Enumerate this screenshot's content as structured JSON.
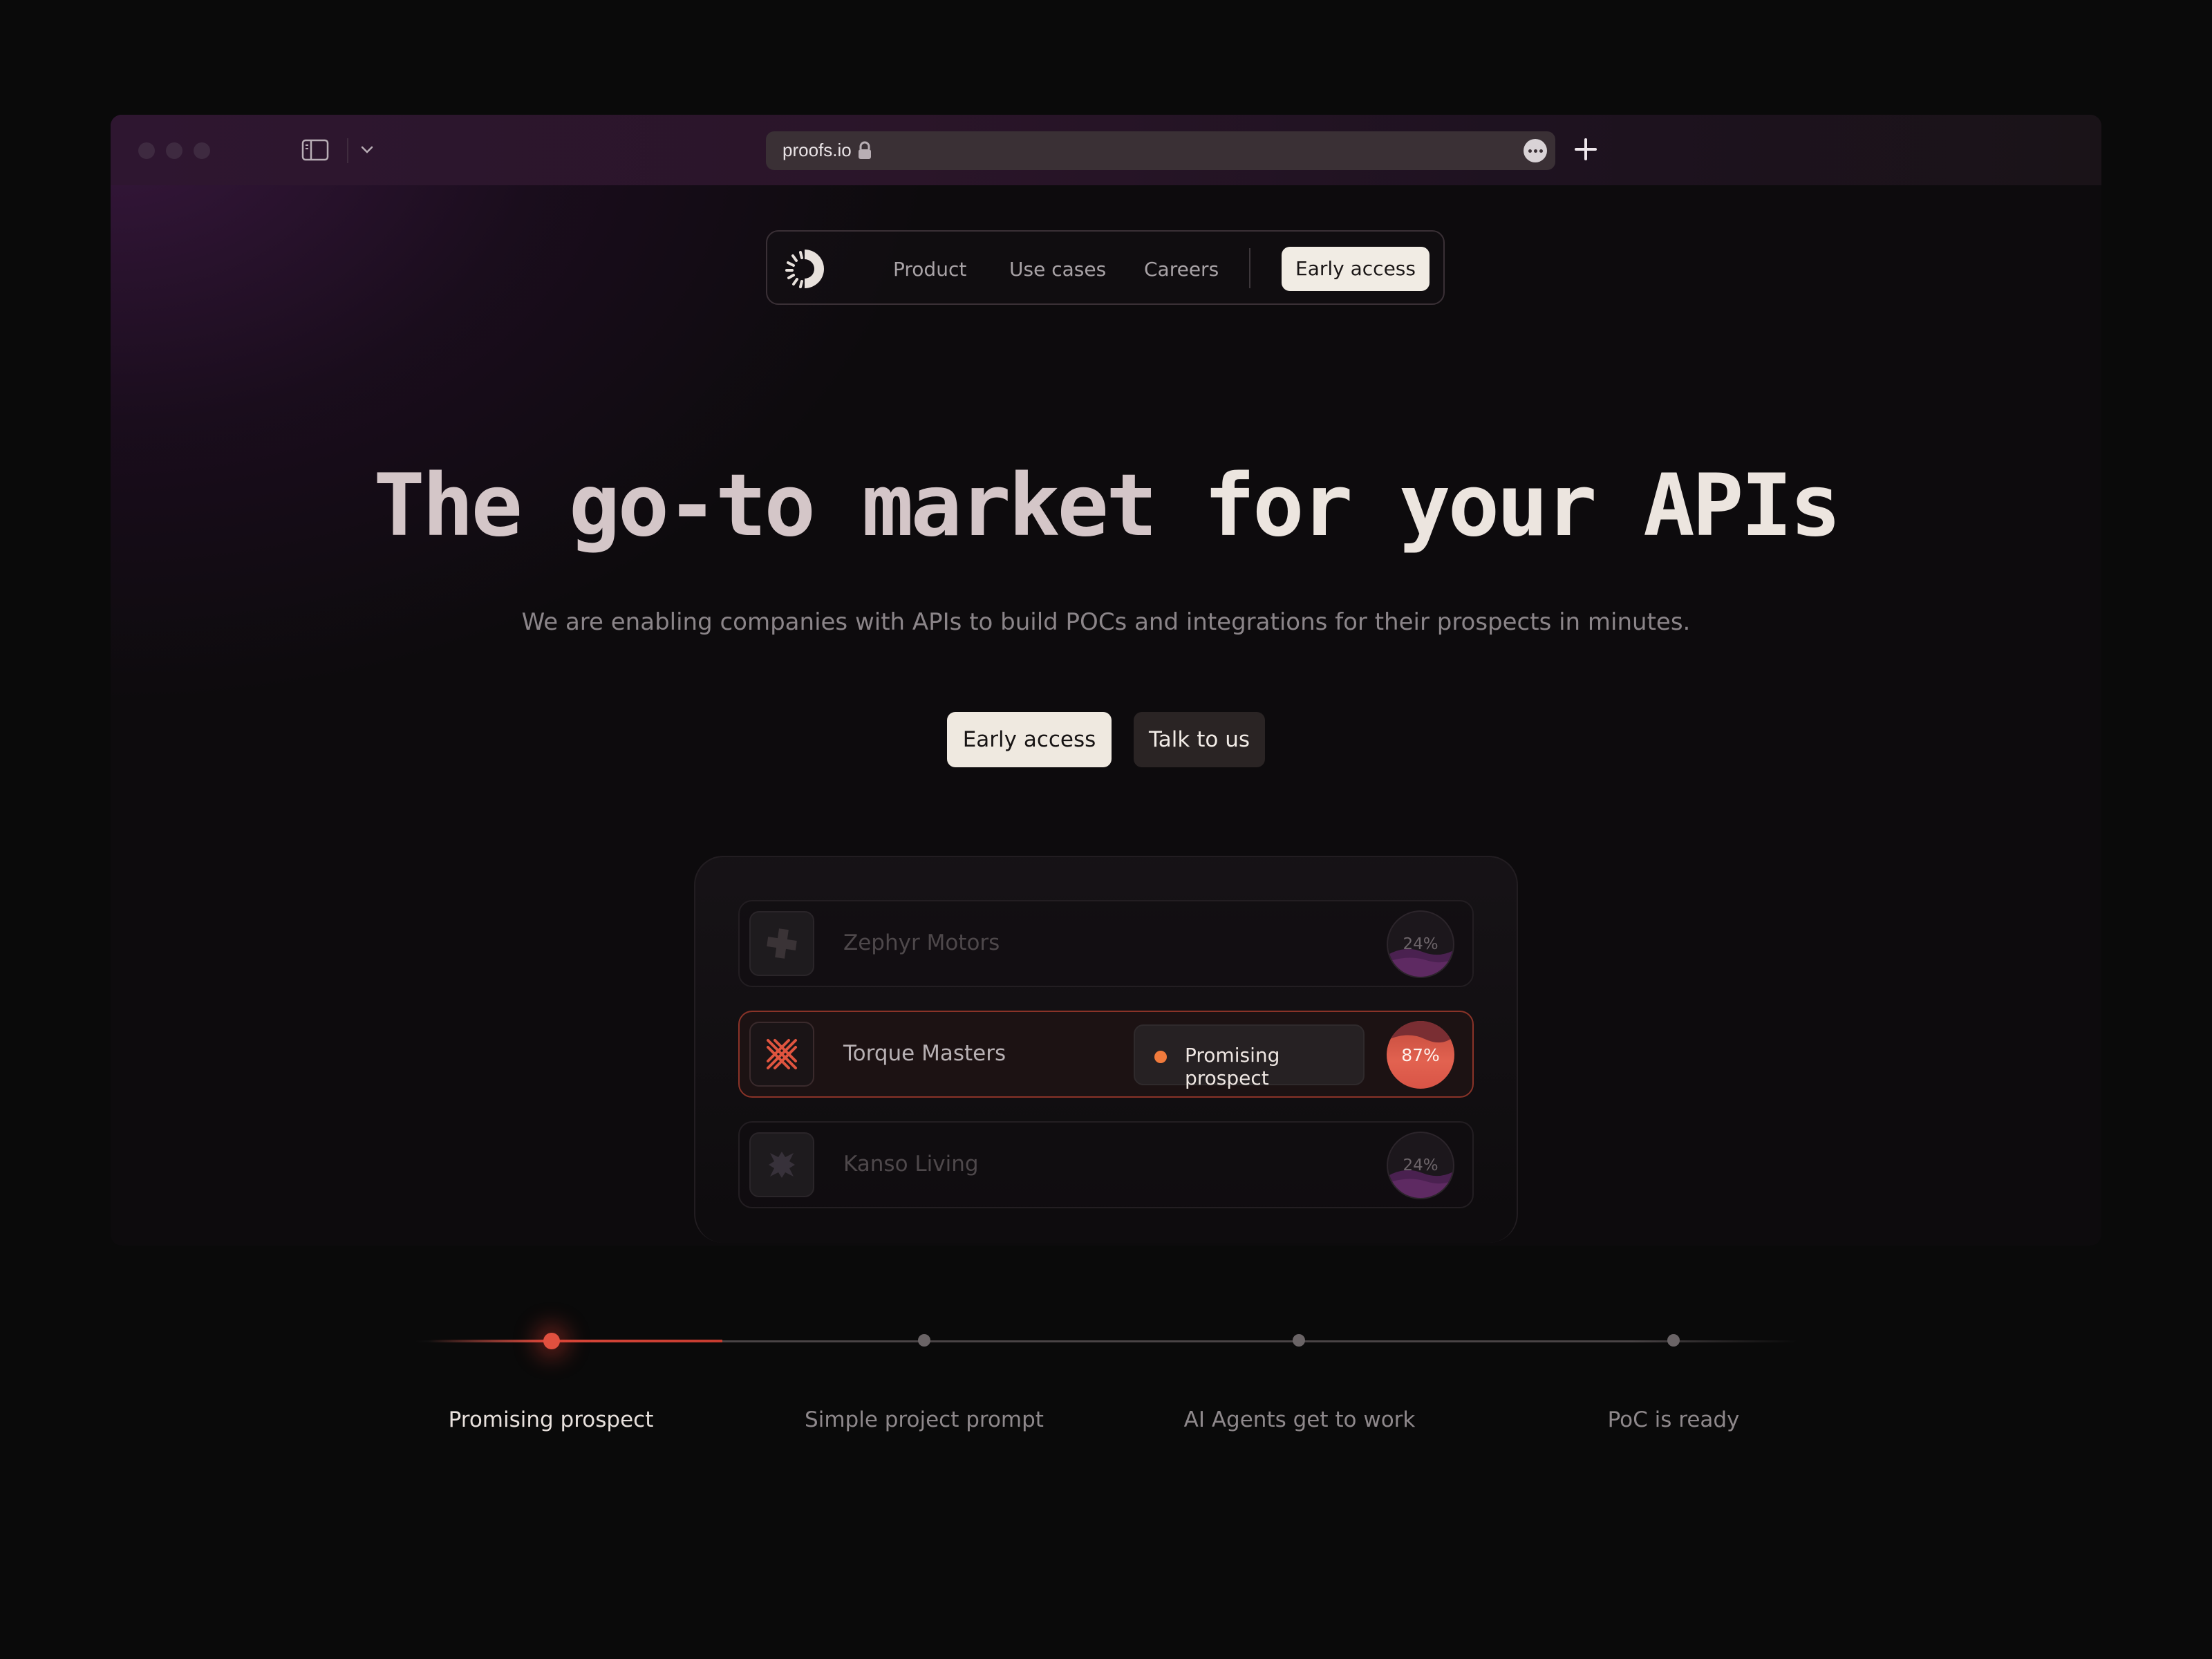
{
  "browser": {
    "url": "proofs.io",
    "icons": [
      "sidebar-icon",
      "chevron-down-icon",
      "back-icon",
      "lock-icon",
      "more-icon",
      "plus-icon"
    ]
  },
  "nav": {
    "links": [
      "Product",
      "Use cases",
      "Careers"
    ],
    "cta": "Early access"
  },
  "hero": {
    "title_part1": "The go-to market",
    "title_part2": "for your APIs",
    "subtitle": "We are enabling companies with APIs to build POCs and integrations for their prospects in minutes.",
    "primary_button": "Early access",
    "secondary_button": "Talk to us"
  },
  "prospects": [
    {
      "name": "Zephyr Motors",
      "score": "24%",
      "state": "faded",
      "icon": "plus-shape-icon"
    },
    {
      "name": "Torque Masters",
      "score": "87%",
      "state": "active",
      "icon": "crosshatch-icon",
      "badge": "Promising prospect"
    },
    {
      "name": "Kanso Living",
      "score": "24%",
      "state": "faded",
      "icon": "asterisk-shape-icon"
    }
  ],
  "timeline": {
    "progress": 0.25,
    "steps": [
      "Promising prospect",
      "Simple project prompt",
      "AI Agents get to work",
      "PoC is ready"
    ],
    "active_step": 0
  },
  "colors": {
    "accent": "#e0503f",
    "badge_dot": "#f07a3c",
    "cta_bg": "#efe9e0",
    "page_bg": "#0a0a0a"
  }
}
